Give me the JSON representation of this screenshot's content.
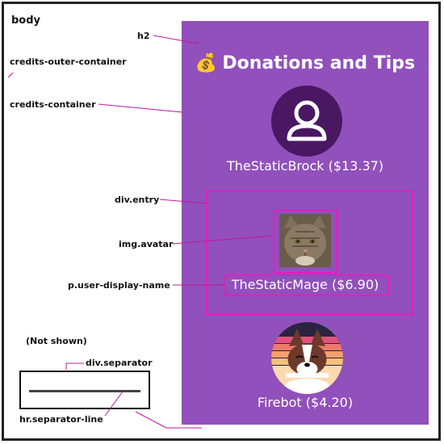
{
  "labels": {
    "body": "body",
    "h2": "h2",
    "outer": "credits-outer-container",
    "container": "credits-container",
    "entry": "div.entry",
    "avatar": "img.avatar",
    "name": "p.user-display-name",
    "not_shown": "(Not shown)",
    "separator": "div.separator",
    "separator_line": "hr.separator-line"
  },
  "panel": {
    "title_icon": "💰",
    "title": "Donations and Tips",
    "entries": [
      {
        "name": "TheStaticBrock ($13.37)",
        "avatar": "user-silhouette-icon"
      },
      {
        "name": "TheStaticMage ($6.90)",
        "avatar": "cat-photo"
      },
      {
        "name": "Firebot ($4.20)",
        "avatar": "corgi-illustration"
      }
    ]
  },
  "colors": {
    "panel": "#9150bb",
    "highlight": "#e020c0",
    "avatar1": "#4a1763"
  }
}
